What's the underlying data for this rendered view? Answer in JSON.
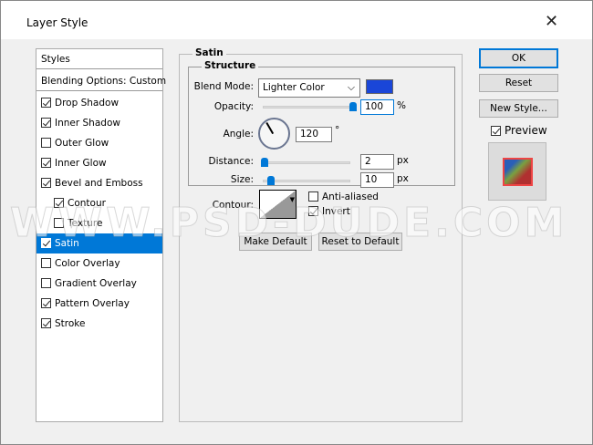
{
  "title": "Layer Style",
  "styles_list": {
    "header": "Styles",
    "blending": "Blending Options: Custom",
    "items": [
      {
        "label": "Drop Shadow",
        "checked": true,
        "indent": false
      },
      {
        "label": "Inner Shadow",
        "checked": true,
        "indent": false
      },
      {
        "label": "Outer Glow",
        "checked": false,
        "indent": false
      },
      {
        "label": "Inner Glow",
        "checked": true,
        "indent": false
      },
      {
        "label": "Bevel and Emboss",
        "checked": true,
        "indent": false
      },
      {
        "label": "Contour",
        "checked": true,
        "indent": true
      },
      {
        "label": "Texture",
        "checked": false,
        "indent": true
      },
      {
        "label": "Satin",
        "checked": true,
        "indent": false,
        "selected": true
      },
      {
        "label": "Color Overlay",
        "checked": false,
        "indent": false
      },
      {
        "label": "Gradient Overlay",
        "checked": false,
        "indent": false
      },
      {
        "label": "Pattern Overlay",
        "checked": true,
        "indent": false
      },
      {
        "label": "Stroke",
        "checked": true,
        "indent": false
      }
    ]
  },
  "satin": {
    "group": "Satin",
    "structure": "Structure",
    "blend_mode_label": "Blend Mode:",
    "blend_mode": "Lighter Color",
    "color": "#1a46d8",
    "opacity_label": "Opacity:",
    "opacity": "100",
    "opacity_unit": "%",
    "angle_label": "Angle:",
    "angle": "120",
    "angle_unit": "°",
    "distance_label": "Distance:",
    "distance": "2",
    "distance_unit": "px",
    "size_label": "Size:",
    "size": "10",
    "size_unit": "px",
    "contour_label": "Contour:",
    "anti_aliased": "Anti-aliased",
    "anti_aliased_checked": false,
    "invert": "Invert",
    "invert_checked": true,
    "make_default": "Make Default",
    "reset_default": "Reset to Default"
  },
  "buttons": {
    "ok": "OK",
    "reset": "Reset",
    "new_style": "New Style...",
    "preview": "Preview",
    "preview_checked": true
  },
  "watermark": "WWW.PSD-DUDE.COM"
}
